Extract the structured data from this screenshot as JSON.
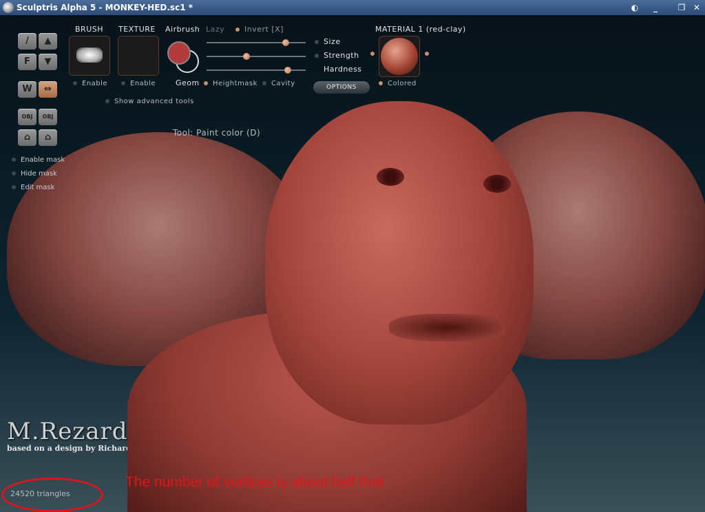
{
  "window": {
    "title": "Sculptris Alpha 5 - MONKEY-HED.sc1 *"
  },
  "left_toolbar": {
    "buttons": [
      {
        "name": "draw-tool",
        "glyph": "/"
      },
      {
        "name": "crease-tool",
        "glyph": "▲"
      },
      {
        "name": "flatten-tool",
        "glyph": "F"
      },
      {
        "name": "smooth-tool",
        "glyph": "▼"
      },
      {
        "name": "symmetry-tool",
        "glyph": "W"
      },
      {
        "name": "move-tool",
        "glyph": "⇔"
      },
      {
        "name": "import-obj",
        "glyph": "OBJ"
      },
      {
        "name": "export-obj",
        "glyph": "OBJ"
      },
      {
        "name": "open-file",
        "glyph": "⌂"
      },
      {
        "name": "save-file",
        "glyph": "⌂"
      }
    ],
    "mask_options": [
      "Enable mask",
      "Hide mask",
      "Edit mask"
    ]
  },
  "panel": {
    "brush_label": "BRUSH",
    "texture_label": "TEXTURE",
    "airbrush_label": "Airbrush",
    "lazy_label": "Lazy",
    "invert_label": "Invert [X]",
    "size_label": "Size",
    "strength_label": "Strength",
    "hardness_label": "Hardness",
    "enable_label": "Enable",
    "geom_label": "Geom",
    "heightmask_label": "Heightmask",
    "cavity_label": "Cavity",
    "options_label": "OPTIONS",
    "advanced_label": "Show advanced tools",
    "material_label": "MATERIAL 1 (red-clay)",
    "colored_label": "Colored",
    "size_value": 0.8,
    "strength_value": 0.4,
    "hardness_value": 0.82,
    "paint_color": "#b33b3b"
  },
  "viewport": {
    "tool_status": "Tool: Paint color (D)",
    "logo_text": "M.Rezard",
    "logo_sub": "based on a design by Richard Dela",
    "triangle_count": "24520 triangles"
  },
  "annotation": {
    "text": "The number of vertices is about half that",
    "color": "#e0141a"
  }
}
